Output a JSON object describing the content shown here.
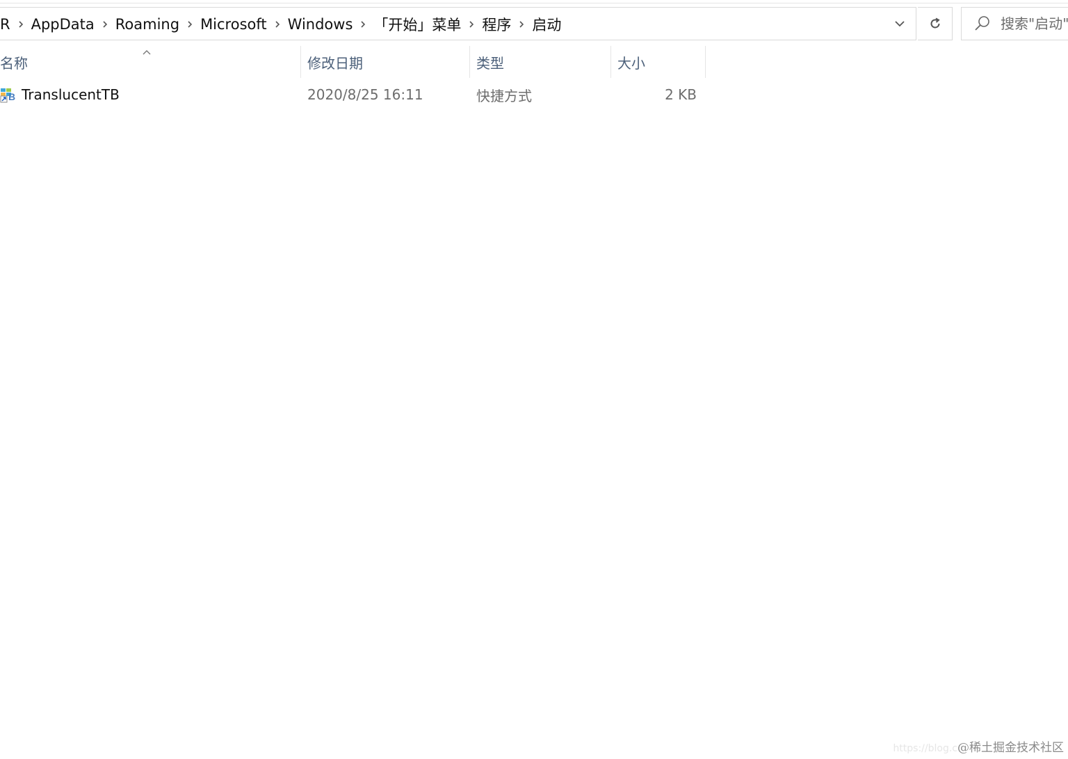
{
  "address_bar": {
    "breadcrumbs": [
      "R",
      "AppData",
      "Roaming",
      "Microsoft",
      "Windows",
      "「开始」菜单",
      "程序",
      "启动"
    ]
  },
  "search": {
    "placeholder": "搜索\"启动\""
  },
  "columns": {
    "name": "名称",
    "date": "修改日期",
    "type": "类型",
    "size": "大小"
  },
  "files": [
    {
      "name": "TranslucentTB",
      "date": "2020/8/25 16:11",
      "type": "快捷方式",
      "size": "2 KB",
      "icon": "shortcut-icon"
    }
  ],
  "watermark": {
    "url": "https://blog.c",
    "site": "@稀土掘金技术社区"
  },
  "colors": {
    "header_text": "#4c607a",
    "border": "#d9d9d9",
    "secondary_text": "#6d6d6d"
  }
}
